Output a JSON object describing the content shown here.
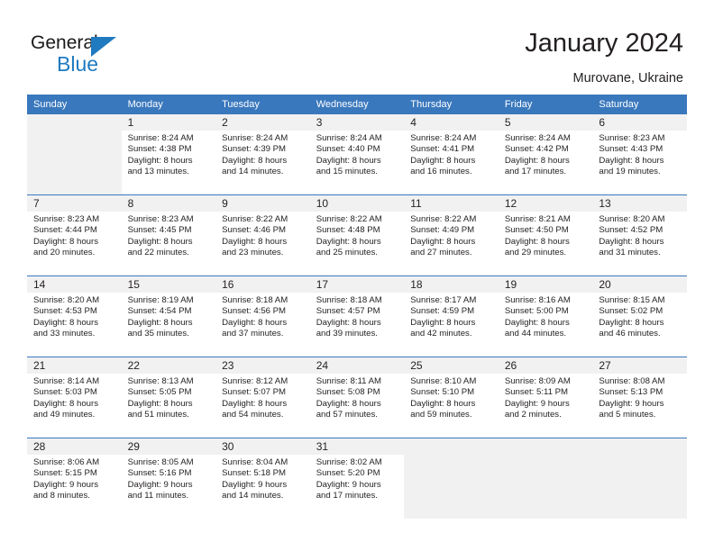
{
  "brand": {
    "name_primary": "General",
    "name_secondary": "Blue",
    "triangle_color": "#1f7ac0"
  },
  "header": {
    "title": "January 2024",
    "location": "Murovane, Ukraine"
  },
  "theme": {
    "header_blue": "#3a78bd",
    "band_gray": "#f1f1f1",
    "text": "#231f20"
  },
  "weekdays": [
    "Sunday",
    "Monday",
    "Tuesday",
    "Wednesday",
    "Thursday",
    "Friday",
    "Saturday"
  ],
  "weeks": [
    [
      {
        "day": "",
        "sunrise": "",
        "sunset": "",
        "daylight_1": "",
        "daylight_2": "",
        "empty": true
      },
      {
        "day": "1",
        "sunrise": "Sunrise: 8:24 AM",
        "sunset": "Sunset: 4:38 PM",
        "daylight_1": "Daylight: 8 hours",
        "daylight_2": "and 13 minutes."
      },
      {
        "day": "2",
        "sunrise": "Sunrise: 8:24 AM",
        "sunset": "Sunset: 4:39 PM",
        "daylight_1": "Daylight: 8 hours",
        "daylight_2": "and 14 minutes."
      },
      {
        "day": "3",
        "sunrise": "Sunrise: 8:24 AM",
        "sunset": "Sunset: 4:40 PM",
        "daylight_1": "Daylight: 8 hours",
        "daylight_2": "and 15 minutes."
      },
      {
        "day": "4",
        "sunrise": "Sunrise: 8:24 AM",
        "sunset": "Sunset: 4:41 PM",
        "daylight_1": "Daylight: 8 hours",
        "daylight_2": "and 16 minutes."
      },
      {
        "day": "5",
        "sunrise": "Sunrise: 8:24 AM",
        "sunset": "Sunset: 4:42 PM",
        "daylight_1": "Daylight: 8 hours",
        "daylight_2": "and 17 minutes."
      },
      {
        "day": "6",
        "sunrise": "Sunrise: 8:23 AM",
        "sunset": "Sunset: 4:43 PM",
        "daylight_1": "Daylight: 8 hours",
        "daylight_2": "and 19 minutes."
      }
    ],
    [
      {
        "day": "7",
        "sunrise": "Sunrise: 8:23 AM",
        "sunset": "Sunset: 4:44 PM",
        "daylight_1": "Daylight: 8 hours",
        "daylight_2": "and 20 minutes."
      },
      {
        "day": "8",
        "sunrise": "Sunrise: 8:23 AM",
        "sunset": "Sunset: 4:45 PM",
        "daylight_1": "Daylight: 8 hours",
        "daylight_2": "and 22 minutes."
      },
      {
        "day": "9",
        "sunrise": "Sunrise: 8:22 AM",
        "sunset": "Sunset: 4:46 PM",
        "daylight_1": "Daylight: 8 hours",
        "daylight_2": "and 23 minutes."
      },
      {
        "day": "10",
        "sunrise": "Sunrise: 8:22 AM",
        "sunset": "Sunset: 4:48 PM",
        "daylight_1": "Daylight: 8 hours",
        "daylight_2": "and 25 minutes."
      },
      {
        "day": "11",
        "sunrise": "Sunrise: 8:22 AM",
        "sunset": "Sunset: 4:49 PM",
        "daylight_1": "Daylight: 8 hours",
        "daylight_2": "and 27 minutes."
      },
      {
        "day": "12",
        "sunrise": "Sunrise: 8:21 AM",
        "sunset": "Sunset: 4:50 PM",
        "daylight_1": "Daylight: 8 hours",
        "daylight_2": "and 29 minutes."
      },
      {
        "day": "13",
        "sunrise": "Sunrise: 8:20 AM",
        "sunset": "Sunset: 4:52 PM",
        "daylight_1": "Daylight: 8 hours",
        "daylight_2": "and 31 minutes."
      }
    ],
    [
      {
        "day": "14",
        "sunrise": "Sunrise: 8:20 AM",
        "sunset": "Sunset: 4:53 PM",
        "daylight_1": "Daylight: 8 hours",
        "daylight_2": "and 33 minutes."
      },
      {
        "day": "15",
        "sunrise": "Sunrise: 8:19 AM",
        "sunset": "Sunset: 4:54 PM",
        "daylight_1": "Daylight: 8 hours",
        "daylight_2": "and 35 minutes."
      },
      {
        "day": "16",
        "sunrise": "Sunrise: 8:18 AM",
        "sunset": "Sunset: 4:56 PM",
        "daylight_1": "Daylight: 8 hours",
        "daylight_2": "and 37 minutes."
      },
      {
        "day": "17",
        "sunrise": "Sunrise: 8:18 AM",
        "sunset": "Sunset: 4:57 PM",
        "daylight_1": "Daylight: 8 hours",
        "daylight_2": "and 39 minutes."
      },
      {
        "day": "18",
        "sunrise": "Sunrise: 8:17 AM",
        "sunset": "Sunset: 4:59 PM",
        "daylight_1": "Daylight: 8 hours",
        "daylight_2": "and 42 minutes."
      },
      {
        "day": "19",
        "sunrise": "Sunrise: 8:16 AM",
        "sunset": "Sunset: 5:00 PM",
        "daylight_1": "Daylight: 8 hours",
        "daylight_2": "and 44 minutes."
      },
      {
        "day": "20",
        "sunrise": "Sunrise: 8:15 AM",
        "sunset": "Sunset: 5:02 PM",
        "daylight_1": "Daylight: 8 hours",
        "daylight_2": "and 46 minutes."
      }
    ],
    [
      {
        "day": "21",
        "sunrise": "Sunrise: 8:14 AM",
        "sunset": "Sunset: 5:03 PM",
        "daylight_1": "Daylight: 8 hours",
        "daylight_2": "and 49 minutes."
      },
      {
        "day": "22",
        "sunrise": "Sunrise: 8:13 AM",
        "sunset": "Sunset: 5:05 PM",
        "daylight_1": "Daylight: 8 hours",
        "daylight_2": "and 51 minutes."
      },
      {
        "day": "23",
        "sunrise": "Sunrise: 8:12 AM",
        "sunset": "Sunset: 5:07 PM",
        "daylight_1": "Daylight: 8 hours",
        "daylight_2": "and 54 minutes."
      },
      {
        "day": "24",
        "sunrise": "Sunrise: 8:11 AM",
        "sunset": "Sunset: 5:08 PM",
        "daylight_1": "Daylight: 8 hours",
        "daylight_2": "and 57 minutes."
      },
      {
        "day": "25",
        "sunrise": "Sunrise: 8:10 AM",
        "sunset": "Sunset: 5:10 PM",
        "daylight_1": "Daylight: 8 hours",
        "daylight_2": "and 59 minutes."
      },
      {
        "day": "26",
        "sunrise": "Sunrise: 8:09 AM",
        "sunset": "Sunset: 5:11 PM",
        "daylight_1": "Daylight: 9 hours",
        "daylight_2": "and 2 minutes."
      },
      {
        "day": "27",
        "sunrise": "Sunrise: 8:08 AM",
        "sunset": "Sunset: 5:13 PM",
        "daylight_1": "Daylight: 9 hours",
        "daylight_2": "and 5 minutes."
      }
    ],
    [
      {
        "day": "28",
        "sunrise": "Sunrise: 8:06 AM",
        "sunset": "Sunset: 5:15 PM",
        "daylight_1": "Daylight: 9 hours",
        "daylight_2": "and 8 minutes."
      },
      {
        "day": "29",
        "sunrise": "Sunrise: 8:05 AM",
        "sunset": "Sunset: 5:16 PM",
        "daylight_1": "Daylight: 9 hours",
        "daylight_2": "and 11 minutes."
      },
      {
        "day": "30",
        "sunrise": "Sunrise: 8:04 AM",
        "sunset": "Sunset: 5:18 PM",
        "daylight_1": "Daylight: 9 hours",
        "daylight_2": "and 14 minutes."
      },
      {
        "day": "31",
        "sunrise": "Sunrise: 8:02 AM",
        "sunset": "Sunset: 5:20 PM",
        "daylight_1": "Daylight: 9 hours",
        "daylight_2": "and 17 minutes."
      },
      {
        "day": "",
        "sunrise": "",
        "sunset": "",
        "daylight_1": "",
        "daylight_2": "",
        "empty": true
      },
      {
        "day": "",
        "sunrise": "",
        "sunset": "",
        "daylight_1": "",
        "daylight_2": "",
        "empty": true
      },
      {
        "day": "",
        "sunrise": "",
        "sunset": "",
        "daylight_1": "",
        "daylight_2": "",
        "empty": true
      }
    ]
  ]
}
